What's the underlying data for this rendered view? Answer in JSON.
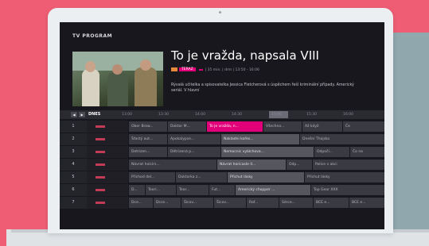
{
  "screen": {
    "title": "TV PROGRAM",
    "program": {
      "title": "To je vražda, napsala VIII",
      "meta": "| 35 min. | drm | 13:50 - 16:06",
      "tag": "TERAZ",
      "description": "Rývalá učitelka a spisovatelka Jessica Fletcherová s úspěchem řeší kriminální případy. Americký seriál. V hlavní"
    },
    "timeline": {
      "day": "DNES",
      "times": [
        "13:00",
        "13:30",
        "14:00",
        "14:30",
        "15:00",
        "15:30",
        "16:00"
      ]
    },
    "rows": [
      {
        "number": "1",
        "programs": [
          "Ober Brow...",
          "Doktor M...",
          "To je vražda, n...",
          "Všechno...",
          "Až když",
          "Če"
        ]
      },
      {
        "number": "2",
        "programs": [
          "Šťastý aut...",
          "Apokalypse...",
          "Nakladni kořes...",
          "Dnešní Thajsko"
        ]
      },
      {
        "number": "3",
        "programs": [
          "Detrizen...",
          "Dětrizená p...",
          "Nemocnic vybíchova...",
          "Odpoči...",
          "Čo na"
        ]
      },
      {
        "number": "4",
        "programs": [
          "Návrat holcirs...",
          "Návrat horicasle II...",
          "Odp...",
          "Police v akci"
        ]
      },
      {
        "number": "5",
        "programs": [
          "Přichod del...",
          "Doktorka z...",
          "Přichut lásky",
          "Přichut lásky"
        ]
      },
      {
        "number": "6",
        "programs": [
          "D...",
          "Teori...",
          "Teor...",
          "Fut...",
          "Americký chopper ...",
          "Top Gear XXX"
        ]
      },
      {
        "number": "7",
        "programs": [
          "Dce...",
          "Dcce...",
          "Šícov...",
          "Šícov...",
          "Raf...",
          "Sérce...",
          "BCE e...",
          "BCE e..."
        ]
      }
    ]
  }
}
